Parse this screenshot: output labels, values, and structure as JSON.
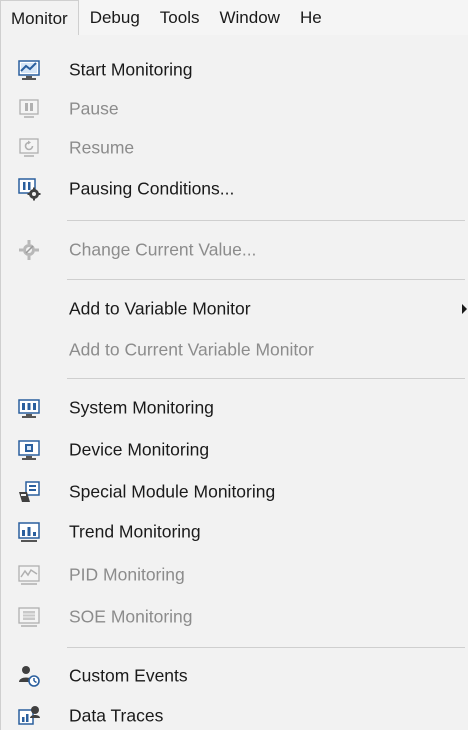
{
  "menubar": {
    "items": [
      "Monitor",
      "Debug",
      "Tools",
      "Window",
      "He"
    ]
  },
  "menu": {
    "start_monitoring": "Start Monitoring",
    "pause": "Pause",
    "resume": "Resume",
    "pausing_conditions": "Pausing Conditions...",
    "change_current_value": "Change Current Value...",
    "add_to_variable_monitor": "Add to Variable Monitor",
    "add_to_current_variable_monitor": "Add to Current Variable Monitor",
    "system_monitoring": "System Monitoring",
    "device_monitoring": "Device Monitoring",
    "special_module_monitoring": "Special Module Monitoring",
    "trend_monitoring": "Trend Monitoring",
    "pid_monitoring": "PID Monitoring",
    "soe_monitoring": "SOE Monitoring",
    "custom_events": "Custom Events",
    "data_traces": "Data Traces"
  },
  "colors": {
    "enabled_text": "#1a1a1a",
    "disabled_text": "#8c8c8c",
    "background": "#f2f2f2",
    "icon_blue": "#2a5f9e",
    "separator": "#cfcfcf"
  }
}
